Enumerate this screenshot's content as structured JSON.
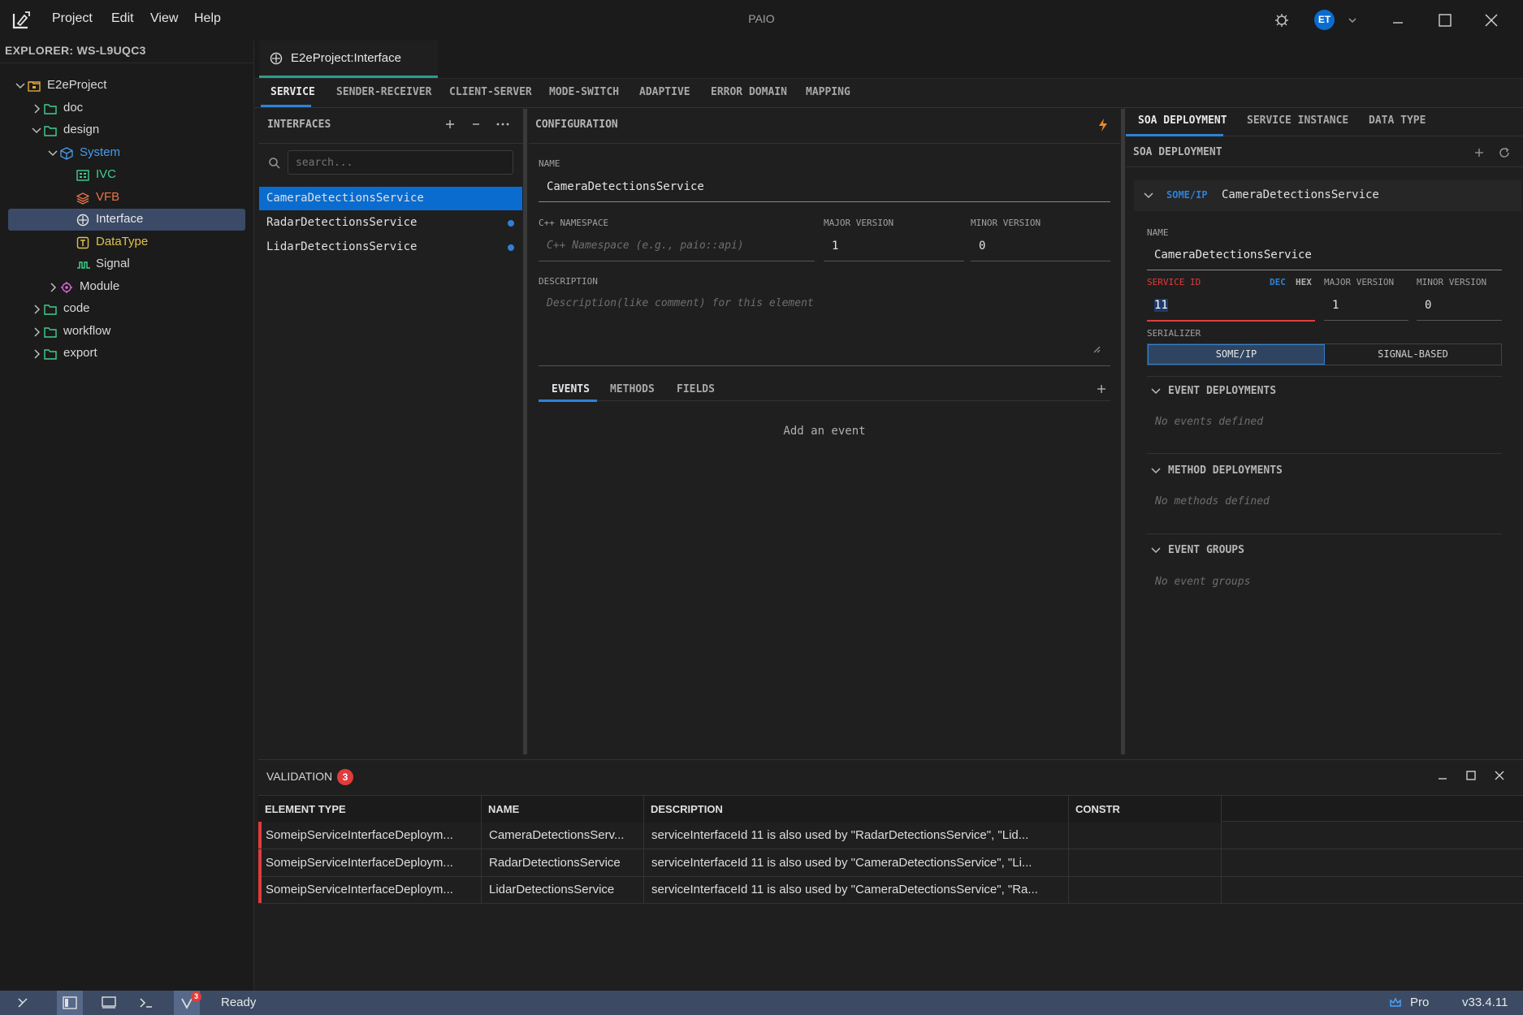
{
  "app": {
    "title": "PAIO",
    "menu": [
      "Project",
      "Edit",
      "View",
      "Help"
    ],
    "user_initials": "ET",
    "accent": "#2f81d6"
  },
  "explorer": {
    "title": "EXPLORER: WS-L9UQC3",
    "tree": [
      {
        "label": "E2eProject",
        "icon": "project-icon",
        "color": "#d8d8d8",
        "expanded": true
      },
      {
        "label": "doc",
        "icon": "folder-icon",
        "color": "#d8d8d8",
        "expanded": false
      },
      {
        "label": "design",
        "icon": "folder-icon",
        "color": "#d8d8d8",
        "expanded": true
      },
      {
        "label": "System",
        "icon": "cube-icon",
        "color": "#4a9be8",
        "expanded": true
      },
      {
        "label": "IVC",
        "icon": "grid-icon",
        "color": "#3fcf8e"
      },
      {
        "label": "VFB",
        "icon": "layers-icon",
        "color": "#e8734a"
      },
      {
        "label": "Interface",
        "icon": "interface-icon",
        "color": "#e8e8e8",
        "selected": true
      },
      {
        "label": "DataType",
        "icon": "datatype-icon",
        "color": "#e0c24a"
      },
      {
        "label": "Signal",
        "icon": "signal-icon",
        "color": "#d8d8d8"
      },
      {
        "label": "Module",
        "icon": "module-icon",
        "color": "#d8d8d8",
        "expanded": false
      },
      {
        "label": "code",
        "icon": "folder-icon",
        "color": "#d8d8d8",
        "expanded": false
      },
      {
        "label": "workflow",
        "icon": "folder-icon",
        "color": "#d8d8d8",
        "expanded": false
      },
      {
        "label": "export",
        "icon": "folder-icon",
        "color": "#d8d8d8",
        "expanded": false
      }
    ]
  },
  "editor": {
    "tab_label": "E2eProject:Interface",
    "categories": [
      "SERVICE",
      "SENDER-RECEIVER",
      "CLIENT-SERVER",
      "MODE-SWITCH",
      "ADAPTIVE",
      "ERROR DOMAIN",
      "MAPPING"
    ],
    "active_category": "SERVICE"
  },
  "interfaces": {
    "title": "INTERFACES",
    "search_placeholder": "search...",
    "items": [
      {
        "name": "CameraDetectionsService",
        "selected": true,
        "modified": false
      },
      {
        "name": "RadarDetectionsService",
        "selected": false,
        "modified": true
      },
      {
        "name": "LidarDetectionsService",
        "selected": false,
        "modified": true
      }
    ]
  },
  "config": {
    "title": "CONFIGURATION",
    "name_label": "NAME",
    "name_value": "CameraDetectionsService",
    "namespace_label": "C++ NAMESPACE",
    "namespace_placeholder": "C++ Namespace (e.g., paio::api)",
    "major_label": "MAJOR VERSION",
    "major_value": "1",
    "minor_label": "MINOR VERSION",
    "minor_value": "0",
    "description_label": "DESCRIPTION",
    "description_placeholder": "Description(like comment) for this element",
    "subtabs": [
      "EVENTS",
      "METHODS",
      "FIELDS"
    ],
    "active_subtab": "EVENTS",
    "empty_text": "Add an event"
  },
  "soa": {
    "tabs": [
      "SOA DEPLOYMENT",
      "SERVICE INSTANCE",
      "DATA TYPE"
    ],
    "active_tab": "SOA DEPLOYMENT",
    "section_title": "SOA DEPLOYMENT",
    "item_tag": "SOME/IP",
    "item_name": "CameraDetectionsService",
    "name_label": "NAME",
    "name_value": "CameraDetectionsService",
    "service_id_label": "SERVICE ID",
    "service_id_value": "11",
    "dec_label": "DEC",
    "hex_label": "HEX",
    "major_label": "MAJOR VERSION",
    "major_value": "1",
    "minor_label": "MINOR VERSION",
    "minor_value": "0",
    "serializer_label": "SERIALIZER",
    "serializer_options": [
      "SOME/IP",
      "SIGNAL-BASED"
    ],
    "serializer_selected": "SOME/IP",
    "event_deployments_title": "EVENT DEPLOYMENTS",
    "event_deployments_empty": "No events defined",
    "method_deployments_title": "METHOD DEPLOYMENTS",
    "method_deployments_empty": "No methods defined",
    "event_groups_title": "EVENT GROUPS",
    "event_groups_empty": "No event groups",
    "error_color": "#e03c3c"
  },
  "validation": {
    "title": "VALIDATION",
    "count": "3",
    "columns": [
      "ELEMENT TYPE",
      "NAME",
      "DESCRIPTION",
      "CONSTR"
    ],
    "rows": [
      {
        "type": "SomeipServiceInterfaceDeploym...",
        "name": "CameraDetectionsServ...",
        "description": "serviceInterfaceId 11 is also used by \"RadarDetectionsService\", \"Lid...",
        "constr": ""
      },
      {
        "type": "SomeipServiceInterfaceDeploym...",
        "name": "RadarDetectionsService",
        "description": "serviceInterfaceId 11 is also used by \"CameraDetectionsService\", \"Li...",
        "constr": ""
      },
      {
        "type": "SomeipServiceInterfaceDeploym...",
        "name": "LidarDetectionsService",
        "description": "serviceInterfaceId 11 is also used by \"CameraDetectionsService\", \"Ra...",
        "constr": ""
      }
    ]
  },
  "statusbar": {
    "status_text": "Ready",
    "badge_count": "3",
    "plan": "Pro",
    "version": "v33.4.11",
    "background": "#3c4b63"
  }
}
